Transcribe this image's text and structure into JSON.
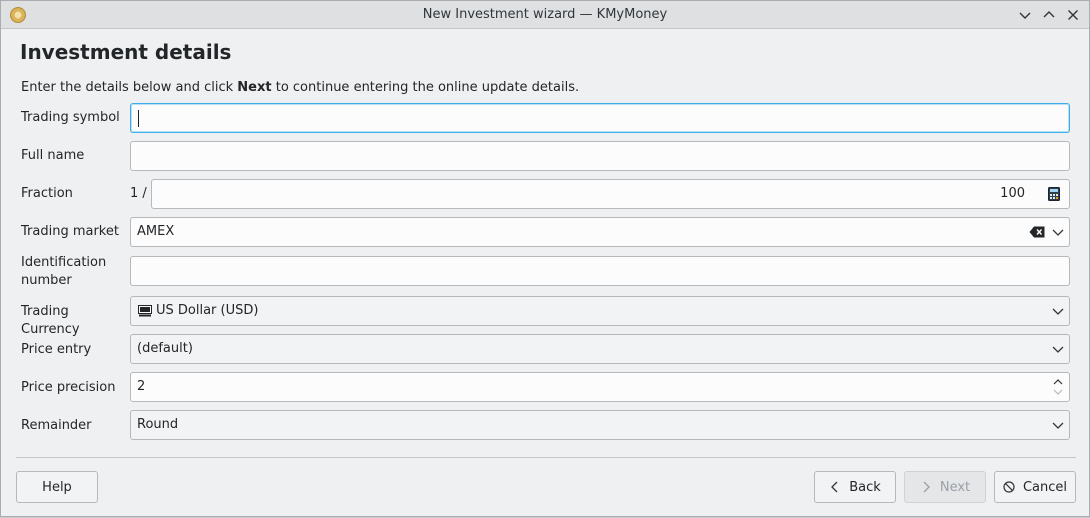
{
  "window": {
    "title": "New Investment wizard — KMyMoney",
    "controls": [
      "minimize-icon",
      "maximize-icon",
      "close-icon"
    ]
  },
  "page": {
    "title": "Investment details",
    "intro_before": "Enter the details below and click ",
    "intro_bold": "Next",
    "intro_after": " to continue entering the online update details."
  },
  "form": {
    "trading_symbol": {
      "label": "Trading symbol",
      "value": ""
    },
    "full_name": {
      "label": "Full name",
      "value": ""
    },
    "fraction": {
      "label": "Fraction",
      "prefix": "1 /",
      "value": "100",
      "icon": "calculator-icon"
    },
    "trading_market": {
      "label": "Trading market",
      "value": "AMEX",
      "icon": "clear-text-icon"
    },
    "identification_number": {
      "label": "Identification number",
      "value": ""
    },
    "trading_currency": {
      "label": "Trading Currency",
      "value": "US Dollar (USD)",
      "icon": "currency-icon"
    },
    "price_entry": {
      "label": "Price entry",
      "value": "(default)"
    },
    "price_precision": {
      "label": "Price precision",
      "value": "2"
    },
    "remainder": {
      "label": "Remainder",
      "value": "Round"
    }
  },
  "buttons": {
    "help": "Help",
    "back": "Back",
    "next": "Next",
    "cancel": "Cancel"
  },
  "colors": {
    "focus_accent": "#3daee9",
    "window_bg": "#eff0f1",
    "titlebar_bg": "#dee0e2"
  }
}
